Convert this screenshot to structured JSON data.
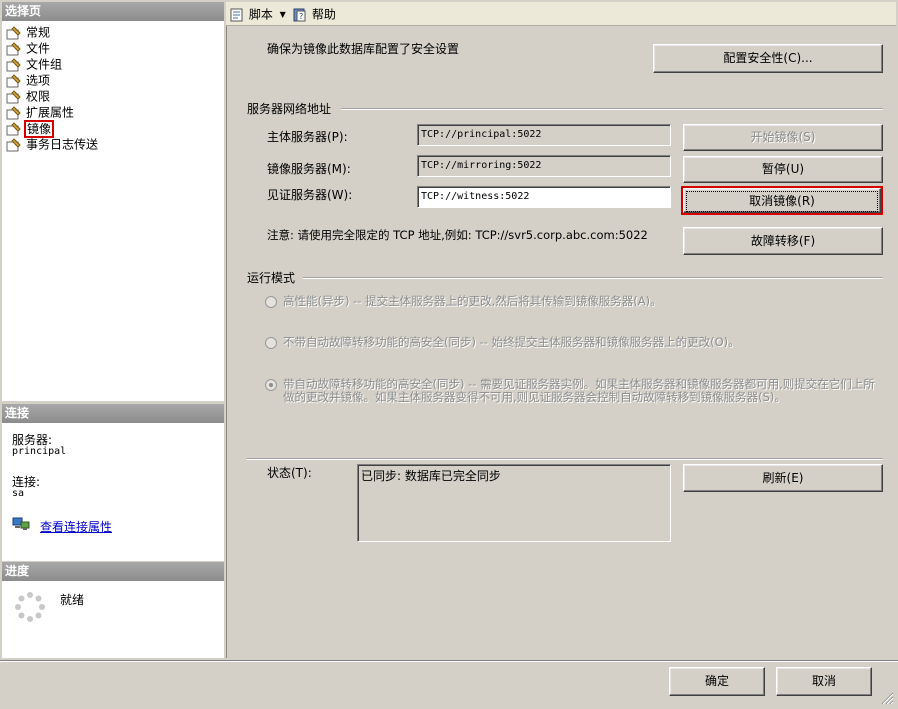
{
  "left_pane": {
    "select_page_header": "选择页",
    "nav_items": [
      {
        "label": "常规"
      },
      {
        "label": "文件"
      },
      {
        "label": "文件组"
      },
      {
        "label": "选项"
      },
      {
        "label": "权限"
      },
      {
        "label": "扩展属性"
      },
      {
        "label": "镜像"
      },
      {
        "label": "事务日志传送"
      }
    ],
    "selected_item": "镜像",
    "connection_header": "连接",
    "server_label": "服务器:",
    "server_value": "principal",
    "connection_label": "连接:",
    "connection_value": "sa",
    "view_connection_link": "查看连接属性",
    "progress_header": "进度",
    "progress_status": "就绪"
  },
  "toolbar": {
    "script_label": "脚本",
    "help_label": "帮助"
  },
  "mirroring": {
    "security_text": "确保为镜像此数据库配置了安全设置",
    "configure_security_button": "配置安全性(C)...",
    "network_group_title": "服务器网络地址",
    "principal_label": "主体服务器(P):",
    "principal_value": "TCP://principal:5022",
    "mirror_label": "镜像服务器(M):",
    "mirror_value": "TCP://mirroring:5022",
    "witness_label": "见证服务器(W):",
    "witness_value": "TCP://witness:5022",
    "start_button": "开始镜像(S)",
    "pause_button": "暂停(U)",
    "remove_button": "取消镜像(R)",
    "failover_button": "故障转移(F)",
    "note_text": "注意: 请使用完全限定的 TCP 地址,例如: TCP://svr5.corp.abc.com:5022",
    "operating_mode_title": "运行模式",
    "modes": [
      {
        "text": "高性能(异步) -- 提交主体服务器上的更改,然后将其传输到镜像服务器(A)。",
        "checked": false
      },
      {
        "text": "不带自动故障转移功能的高安全(同步) -- 始终提交主体服务器和镜像服务器上的更改(O)。",
        "checked": false
      },
      {
        "text": "带自动故障转移功能的高安全(同步) -- 需要见证服务器实例。如果主体服务器和镜像服务器都可用,则提交在它们上所做的更改并镜像。如果主体服务器变得不可用,则见证服务器会控制自动故障转移到镜像服务器(S)。",
        "checked": true
      }
    ],
    "status_label": "状态(T):",
    "status_value": "已同步: 数据库已完全同步",
    "refresh_button": "刷新(E)"
  },
  "footer": {
    "ok_button": "确定",
    "cancel_button": "取消"
  },
  "colors": {
    "dialog_bg": "#d4d0c8",
    "section_header": "#8c8c8c",
    "highlight_red": "#d40000",
    "link_blue": "#0000cc"
  }
}
